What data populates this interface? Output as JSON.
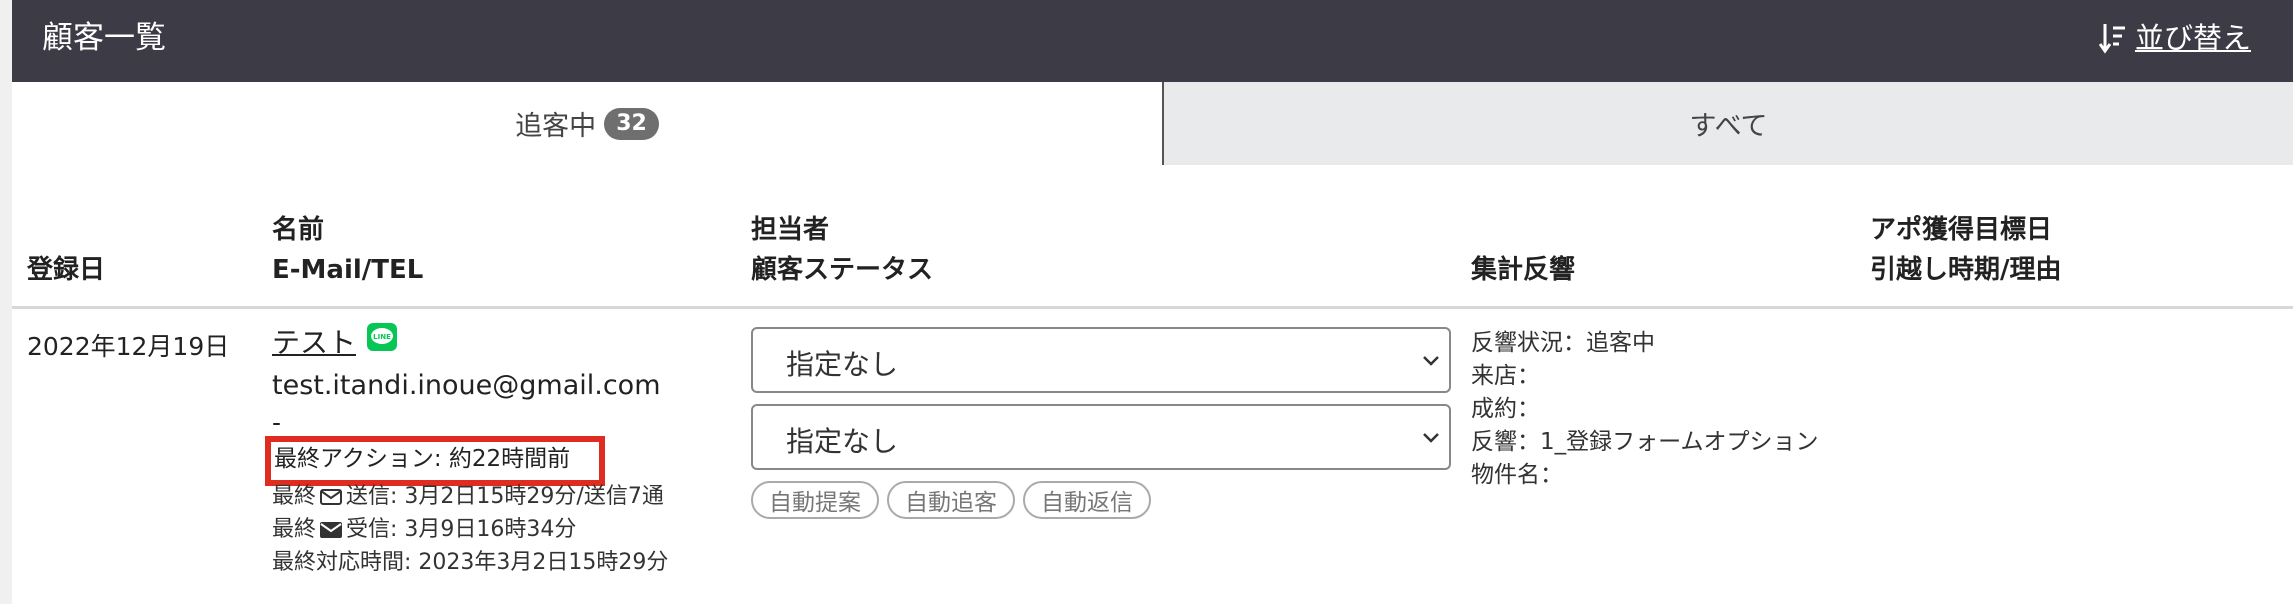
{
  "header": {
    "title": "顧客一覧",
    "sort_label": "並び替え"
  },
  "tabs": [
    {
      "label": "追客中",
      "badge": "32"
    },
    {
      "label": "すべて"
    }
  ],
  "columns": {
    "registered": "登録日",
    "name_line1": "名前",
    "name_line2": "E-Mail/TEL",
    "staff_line1": "担当者",
    "staff_line2": "顧客ステータス",
    "response": "集計反響",
    "appo_line1": "アポ獲得目標日",
    "appo_line2": "引越し時期/理由"
  },
  "row": {
    "registered": "2022年12月19日",
    "name": "テスト",
    "email": "test.itandi.inoue@gmail.com",
    "tel": "-",
    "last_action": "最終アクション: 約22時間前",
    "last_sent_prefix": "最終",
    "last_sent_text": "送信: 3月2日15時29分/送信7通",
    "last_recv_prefix": "最終",
    "last_recv_text": "受信: 3月9日16時34分",
    "last_response": "最終対応時間: 2023年3月2日15時29分",
    "staff_select": "指定なし",
    "status_select": "指定なし",
    "pills": [
      "自動提案",
      "自動追客",
      "自動返信"
    ],
    "stats": [
      "反響状況：追客中",
      "来店：",
      "成約：",
      "反響：1_登録フォームオプション",
      "物件名："
    ]
  },
  "icons": {
    "sort": "sort-icon",
    "line": "line-icon",
    "mail_outline": "mail-outline-icon",
    "mail_filled": "mail-filled-icon",
    "chevron": "chevron-down-icon"
  },
  "colors": {
    "header_bg": "#3d3b45",
    "highlight": "#e02b20",
    "line_green": "#06c755"
  }
}
